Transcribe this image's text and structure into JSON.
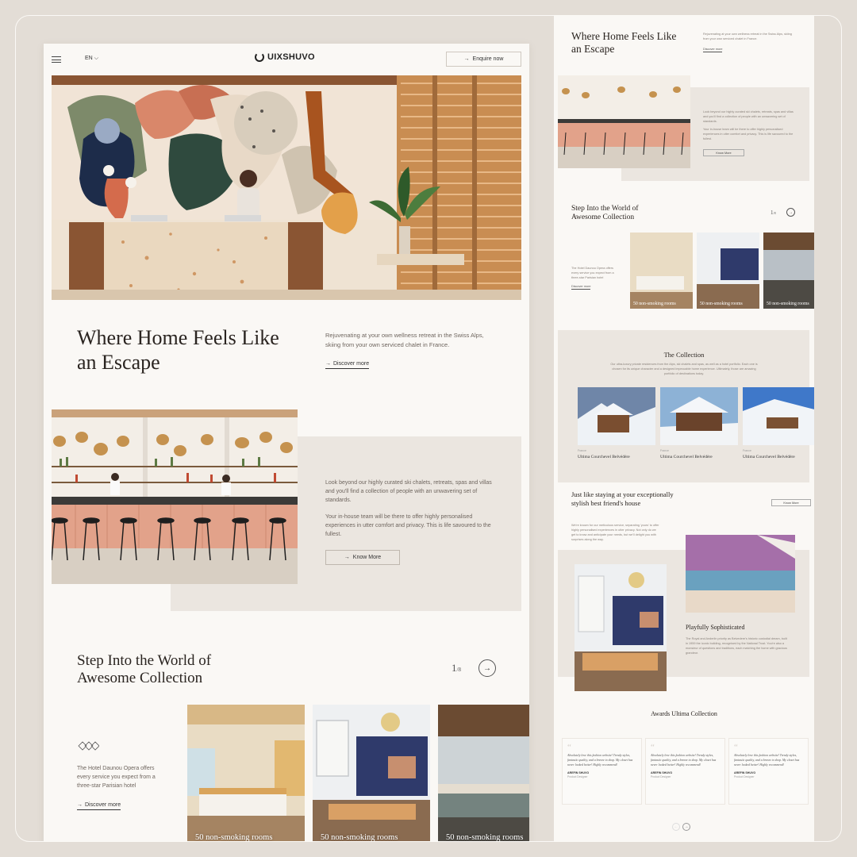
{
  "header": {
    "lang": "EN",
    "logo": "UIXSHUVO",
    "enquire": "Enquire now"
  },
  "hero": {
    "title": "Where Home Feels Like an Escape",
    "desc": "Rejuvenating at your own wellness retreat in the Swiss Alps, skiing from your own serviced chalet in France.",
    "link": "Discover more"
  },
  "bar_section": {
    "p1": "Look beyond our highly curated ski chalets, retreats, spas and villas and you'll find a collection of people with an unwavering set of standards.",
    "p2": "Your in-house team will be there to offer highly personalised experiences in utter comfort and privacy. This is life savoured to the fullest.",
    "button": "Know More"
  },
  "collection": {
    "title": "Step Into the World of Awesome Collection",
    "counter_current": "1",
    "counter_total": "/8",
    "desc": "The Hotel Daunou Opera offers every service you expect from a three-star Parisian hotel",
    "link": "Discover more",
    "cards": [
      {
        "label": "50 non-smoking rooms"
      },
      {
        "label": "50 non-smoking rooms"
      },
      {
        "label": "50 non-smoking rooms"
      }
    ]
  },
  "side": {
    "title": "Where Home Feels Like an Escape",
    "desc": "Rejuvenating at your own wellness retreat in the Swiss Alps, skiing from your own serviced chalet in France.",
    "link": "Discover more",
    "bar_p1": "Look beyond our highly curated ski chalets, retreats, spas and villas and you'll find a collection of people with an unwavering set of standards.",
    "bar_p2": "Your in-house team will be there to offer highly personalised experiences in utter comfort and privacy. This is life savoured to the fullest.",
    "bar_btn": "Know More",
    "step_title": "Step Into the World of Awesome Collection",
    "counter_current": "1",
    "counter_total": "/8",
    "step_desc": "The Hotel Daunou Opera offers every service you expect from a three-star Parisian hotel",
    "step_link": "Discover more",
    "card_label": "50 non-smoking rooms",
    "coll_title": "The Collection",
    "coll_desc": "Our ultra-luxury private residences from the Alps, ski chalets and spas, as well as a hotel portfolio. Each one is chosen for its unique character and a designed impeccable home experience. Ultimately, those are amazing portfolio of destinations today.",
    "chalets": [
      {
        "sub": "France",
        "name": "Ultima Courchevel Belvédère"
      },
      {
        "sub": "France",
        "name": "Ultima Courchevel Belvédère"
      },
      {
        "sub": "France",
        "name": "Ultima Courchevel Belvédère"
      }
    ],
    "friend_title": "Just like staying at your exceptionally stylish best friend's house",
    "friend_btn": "Know More",
    "friend_desc": "We're known for our meticulous service, separating 'yours' to offer highly personalised experiences in utter privacy. Not only do we get to know and anticipate your needs, but we'll delight you with surprises along the way.",
    "playful_title": "Playfully Sophisticated",
    "playful_desc": "The Royal and Anderlin priority as Belvedere's historic custodial dream, built in 1959 the iconic building, recognised by the National Trust. You're also a monsieur of questions and traditions, each matching the home with gracious grandeur.",
    "awards_title": "Awards Ultima Collection",
    "reviews": [
      {
        "quote": "Absolutely love this fashion website! Trendy styles, fantastic quality, and a breeze to shop. My closet has never looked better! Highly recommend!",
        "name": "AREFIN SHUVO",
        "role": "Product Designer"
      },
      {
        "quote": "Absolutely love this fashion website! Trendy styles, fantastic quality, and a breeze to shop. My closet has never looked better! Highly recommend!",
        "name": "AREFIN SHUVO",
        "role": "Product Designer"
      },
      {
        "quote": "Absolutely love this fashion website! Trendy styles, fantastic quality, and a breeze to shop. My closet has never looked better! Highly recommend!",
        "name": "AREFIN SHUVO",
        "role": "Product Designer"
      }
    ]
  },
  "icons": {
    "menu": "hamburger-menu-icon",
    "chevron": "chevron-down-icon",
    "arrow": "arrow-right-icon",
    "next": "arrow-right-circle-icon",
    "diamond": "diamond-icon",
    "quote": "quote-icon"
  },
  "colors": {
    "background": "#e3ddd6",
    "page": "#faf8f5",
    "beige_block": "#ebe6e0",
    "text_dark": "#2a2420"
  }
}
